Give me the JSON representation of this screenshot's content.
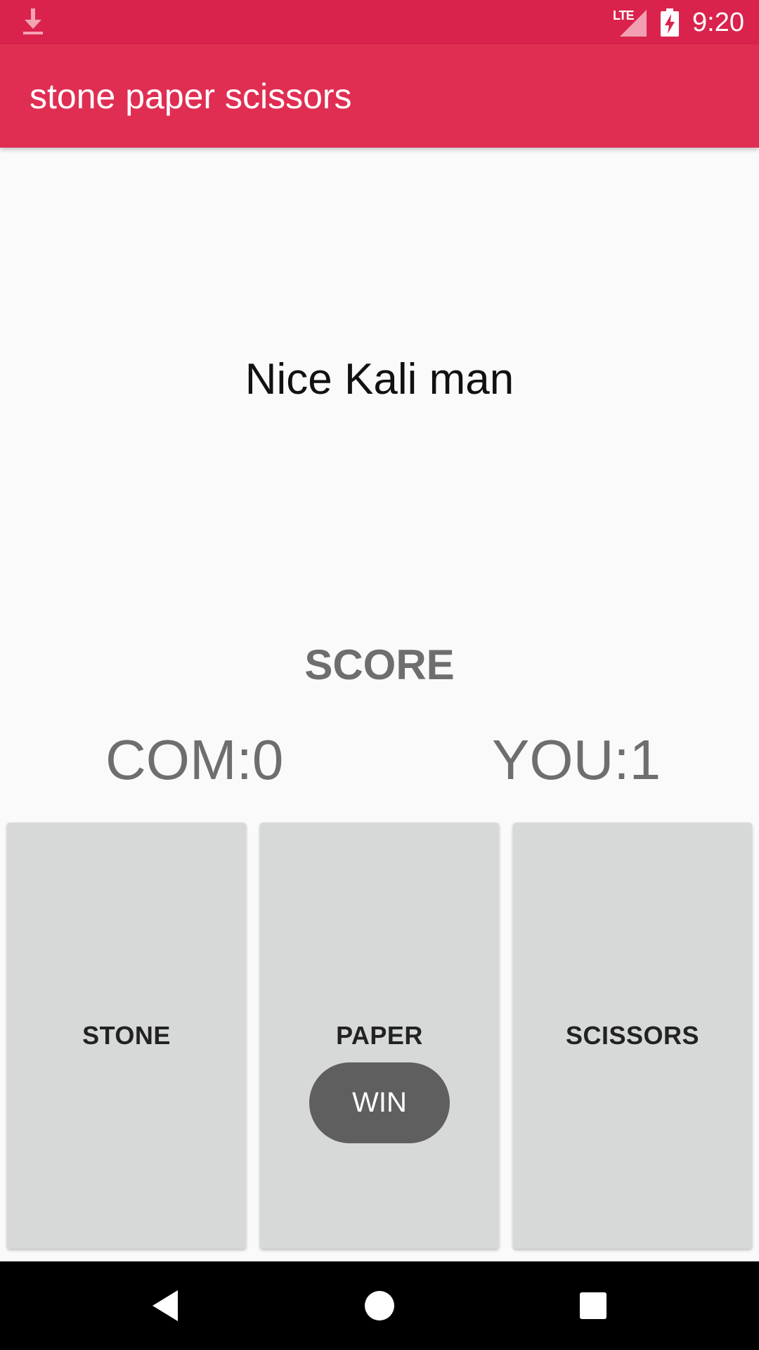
{
  "status_bar": {
    "network_label": "LTE",
    "time": "9:20",
    "background_color": "#d9234c",
    "icons": [
      "download-icon",
      "signal-icon",
      "battery-charging-icon"
    ]
  },
  "app_bar": {
    "title": "stone paper scissors",
    "background_color": "#e02e53"
  },
  "main": {
    "message": "Nice Kali man",
    "score_title": "SCORE",
    "com_score": "COM:0",
    "you_score": "YOU:1"
  },
  "choices": {
    "stone": "STONE",
    "paper": "PAPER",
    "scissors": "SCISSORS"
  },
  "toast": {
    "text": "WIN"
  },
  "nav_bar": {
    "icons": [
      "back-icon",
      "home-icon",
      "recents-icon"
    ]
  }
}
